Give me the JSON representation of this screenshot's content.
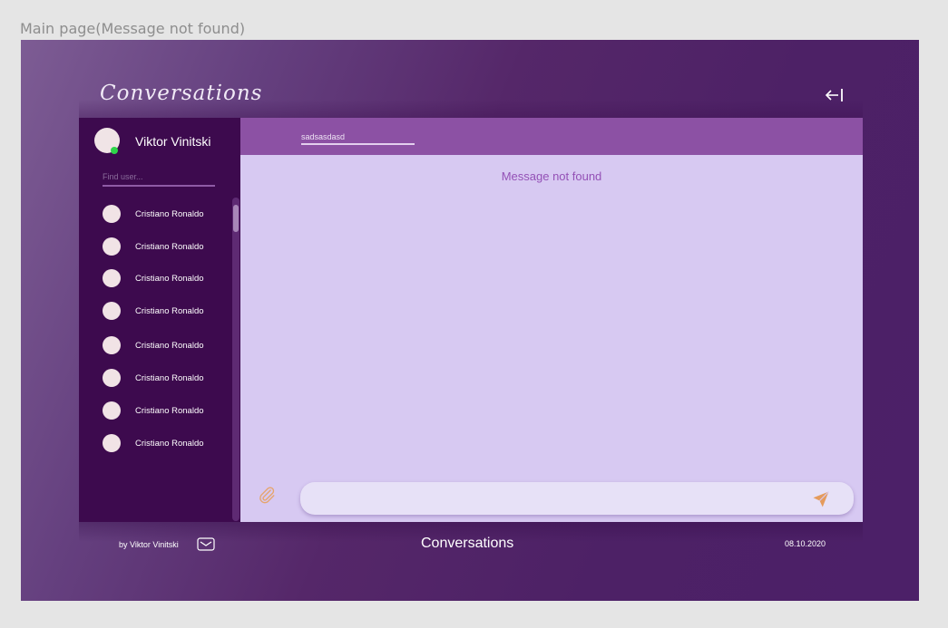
{
  "frame": {
    "label": "Main page(Message not found)"
  },
  "header": {
    "title": "Conversations",
    "exit_icon": "exit-arrow-icon"
  },
  "sidebar": {
    "current_user": {
      "name": "Viktor Vinitski",
      "status": "online",
      "status_color": "#2ed64a"
    },
    "search": {
      "placeholder": "Find user..."
    },
    "users": [
      {
        "name": "Cristiano Ronaldo"
      },
      {
        "name": "Cristiano Ronaldo"
      },
      {
        "name": "Cristiano Ronaldo"
      },
      {
        "name": "Cristiano Ronaldo"
      },
      {
        "name": "Cristiano Ronaldo"
      },
      {
        "name": "Cristiano Ronaldo"
      },
      {
        "name": "Cristiano Ronaldo"
      },
      {
        "name": "Cristiano Ronaldo"
      }
    ]
  },
  "chat": {
    "search_value": "sadsasdasd",
    "empty_message": "Message not found",
    "message_input": {
      "value": ""
    },
    "attach_icon": "paperclip-icon",
    "send_icon": "send-icon"
  },
  "footer": {
    "author": "by Viktor Vinitski",
    "title": "Conversations",
    "date": "08.10.2020",
    "mail_icon": "envelope-icon"
  },
  "colors": {
    "sidebar_bg": "#3d0a4e",
    "chat_header_bg": "#8c51a4",
    "chat_bg": "#d7c9f2",
    "accent_text": "#9451b6",
    "send_icon": "#e59b5c"
  }
}
